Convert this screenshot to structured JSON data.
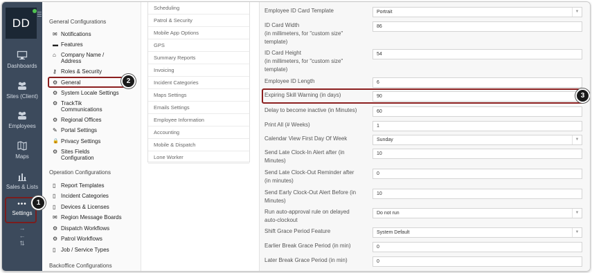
{
  "rail": {
    "avatar": "DD",
    "items": [
      {
        "label": "Dashboards",
        "icon": "monitor-icon"
      },
      {
        "label": "Sites (Client)",
        "icon": "people-icon"
      },
      {
        "label": "Employees",
        "icon": "people-icon"
      },
      {
        "label": "Maps",
        "icon": "map-icon"
      },
      {
        "label": "Sales & Lists",
        "icon": "bar-chart-icon"
      },
      {
        "label": "Settings",
        "icon": "ellipsis-icon"
      }
    ],
    "settings_glyph": "•••",
    "arrows": [
      "→",
      "←",
      "⇅"
    ]
  },
  "nav": {
    "general_heading": "General Configurations",
    "general_items": [
      {
        "label": "Notifications",
        "icon": "✉"
      },
      {
        "label": "Features",
        "icon": "▬"
      },
      {
        "label": "Company Name / Address",
        "icon": "⌂"
      },
      {
        "label": "Roles & Security",
        "icon": "⚷"
      },
      {
        "label": "General",
        "icon": "⚙"
      },
      {
        "label": "System Locale Settings",
        "icon": "⚙"
      },
      {
        "label": "TrackTik Communications",
        "icon": "⚙"
      },
      {
        "label": "Regional Offices",
        "icon": "⚙"
      },
      {
        "label": "Portal Settings",
        "icon": "✎"
      },
      {
        "label": "Privacy Settings",
        "icon": "🔒"
      },
      {
        "label": "Sites Fields Configuration",
        "icon": "⚙"
      }
    ],
    "operation_heading": "Operation Configurations",
    "operation_items": [
      {
        "label": "Report Templates",
        "icon": "▯"
      },
      {
        "label": "Incident Categories",
        "icon": "▯"
      },
      {
        "label": "Devices & Licenses",
        "icon": "▯"
      },
      {
        "label": "Region Message Boards",
        "icon": "✉"
      },
      {
        "label": "Dispatch Workflows",
        "icon": "⚙"
      },
      {
        "label": "Patrol Workflows",
        "icon": "⚙"
      },
      {
        "label": "Job / Service Types",
        "icon": "▯"
      }
    ],
    "backoffice_heading": "Backoffice Configurations"
  },
  "submenu": [
    "Scheduling",
    "Patrol & Security",
    "Mobile App Options",
    "GPS",
    "Summary Reports",
    "Invoicing",
    "Incident Categories",
    "Maps Settings",
    "Emails Settings",
    "Employee Information",
    "Accounting",
    "Mobile & Dispatch",
    "Lone Worker"
  ],
  "form": {
    "fields": [
      {
        "label": "Employee ID Card Template",
        "value": "Portrait",
        "type": "select"
      },
      {
        "label": "ID Card Width\n(in millimeters, for \"custom size\" template)",
        "value": "86",
        "type": "input"
      },
      {
        "label": "ID Card Height\n(in millimeters, for \"custom size\" template)",
        "value": "54",
        "type": "input"
      },
      {
        "label": "Employee ID Length",
        "value": "6",
        "type": "input"
      },
      {
        "label": "Expiring Skill Warning (in days)",
        "value": "90",
        "type": "input"
      },
      {
        "label": "Delay to become inactive (in Minutes)",
        "value": "60",
        "type": "input"
      },
      {
        "label": "Print All (# Weeks)",
        "value": "1",
        "type": "input"
      },
      {
        "label": "Calendar View First Day Of Week",
        "value": "Sunday",
        "type": "select"
      },
      {
        "label": "Send Late Clock-In Alert after (in Minutes)",
        "value": "10",
        "type": "input"
      },
      {
        "label": "Send Late Clock-Out Reminder after (in minutes)",
        "value": "0",
        "type": "input"
      },
      {
        "label": "Send Early Clock-Out Alert Before (in Minutes)",
        "value": "10",
        "type": "input"
      },
      {
        "label": "Run auto-approval rule on delayed auto-clockout",
        "value": "Do not run",
        "type": "select"
      },
      {
        "label": "Shift Grace Period Feature",
        "value": "System Default",
        "type": "select"
      },
      {
        "label": "Earlier Break Grace Period (in min)",
        "value": "0",
        "type": "input"
      },
      {
        "label": "Later Break Grace Period (in min)",
        "value": "0",
        "type": "input"
      }
    ]
  },
  "callouts": [
    "1",
    "2",
    "3"
  ]
}
